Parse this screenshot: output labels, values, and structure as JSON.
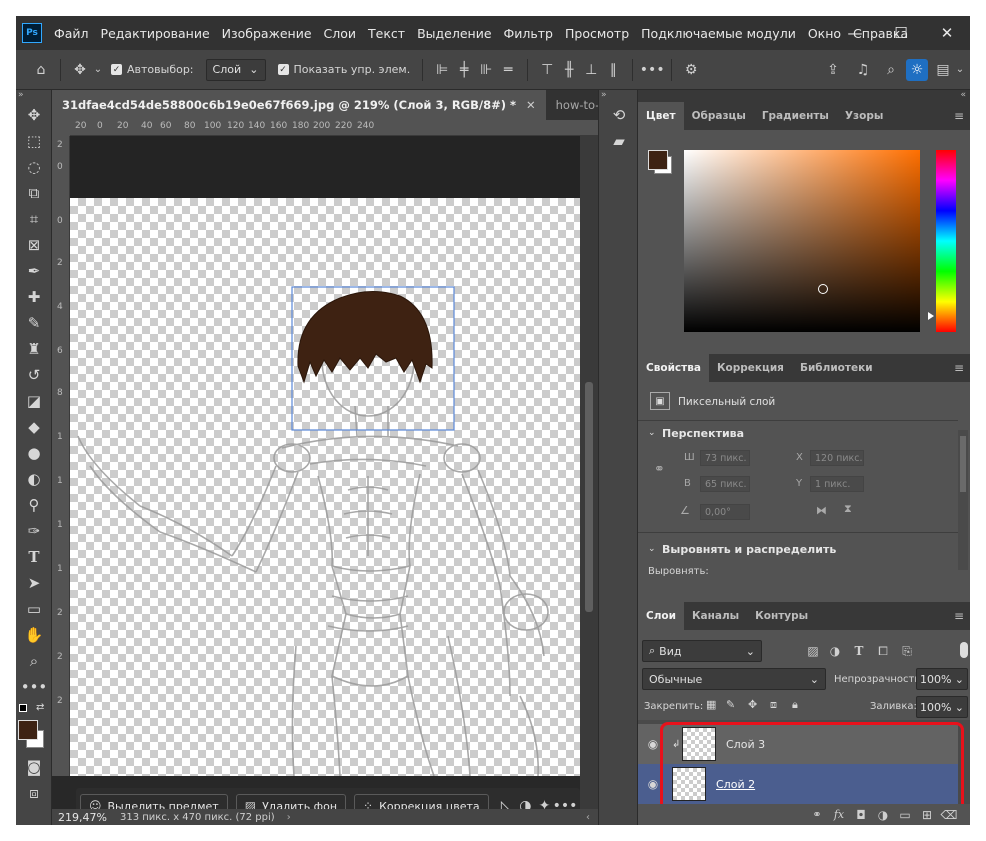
{
  "menubar": {
    "logo": "Ps",
    "items": [
      "Файл",
      "Редактирование",
      "Изображение",
      "Слои",
      "Текст",
      "Выделение",
      "Фильтр",
      "Просмотр",
      "Подключаемые модули",
      "Окно",
      "Справка"
    ],
    "minimize": "—",
    "maximize": "☐",
    "close": "✕"
  },
  "options": {
    "autoselect_label": "Автовыбор:",
    "autoselect_value": "Слой",
    "show_transform_label": "Показать упр. элем.",
    "more": "•••"
  },
  "document": {
    "tabs": [
      {
        "label": "31dfae4cd54de58800c6b19e0e67f669.jpg @ 219% (Слой 3, RGB/8#) *",
        "close": "✕"
      },
      {
        "label": "how-to-draw-anin",
        "close": ""
      }
    ],
    "ruler_h": [
      "20",
      "0",
      "20",
      "40",
      "60",
      "80",
      "100",
      "120",
      "140",
      "160",
      "180",
      "200",
      "220",
      "240"
    ],
    "ruler_v": [
      "2",
      "0",
      "0",
      "2",
      "4",
      "6",
      "8",
      "1",
      "1",
      "1",
      "1",
      "2",
      "2",
      "2"
    ]
  },
  "context_bar": {
    "select_subject": "Выделить предмет",
    "remove_bg": "Удалить фон",
    "color_correction": "Коррекция цвета",
    "more": "•••"
  },
  "status": {
    "zoom": "219,47%",
    "info": "313 пикс. x 470 пикс. (72 ppi)"
  },
  "color_panel": {
    "tabs": [
      "Цвет",
      "Образцы",
      "Градиенты",
      "Узоры"
    ],
    "foreground": "#3d2314",
    "hue_color": "#ff6f00"
  },
  "properties_panel": {
    "tabs": [
      "Свойства",
      "Коррекция",
      "Библиотеки"
    ],
    "layer_type": "Пиксельный слой",
    "perspective_title": "Перспектива",
    "w_label": "Ш",
    "w_value": "73 пикс.",
    "x_label": "X",
    "x_value": "120 пикс.",
    "h_label": "В",
    "h_value": "65 пикс.",
    "y_label": "Y",
    "y_value": "1 пикс.",
    "angle_value": "0,00°",
    "align_title": "Выровнять и распределить",
    "align_label": "Выровнять:"
  },
  "layers_panel": {
    "tabs": [
      "Слои",
      "Каналы",
      "Контуры"
    ],
    "filter_value": "Вид",
    "blend_mode": "Обычные",
    "opacity_label": "Непрозрачность:",
    "opacity_value": "100%",
    "lock_label": "Закрепить:",
    "fill_label": "Заливка:",
    "fill_value": "100%",
    "layers": [
      {
        "name": "Слой 3",
        "selected": false
      },
      {
        "name": "Слой 2",
        "selected": true
      }
    ],
    "highlight_color": "#e8111b",
    "selected_color": "#4b5e8f"
  }
}
